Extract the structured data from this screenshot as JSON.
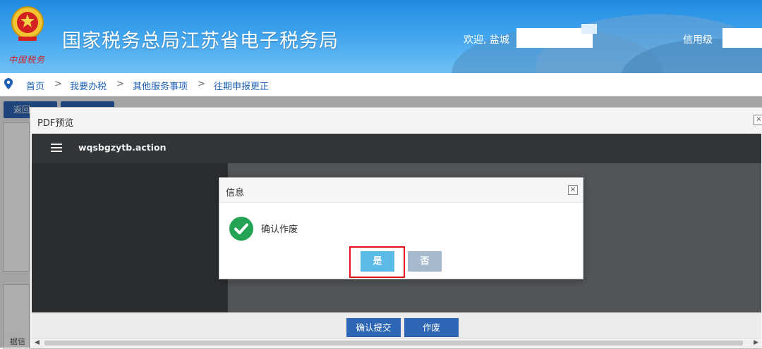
{
  "header": {
    "site_title": "国家税务总局江苏省电子税务局",
    "emblem_caption": "中国税务",
    "welcome": "欢迎, 盐城",
    "credit_label": "信用级"
  },
  "breadcrumb": [
    "首页",
    "我要办税",
    "其他服务事项",
    "往期申报更正"
  ],
  "breadcrumb_separator": ">",
  "page": {
    "back_button": "返回",
    "footer_text": "据信"
  },
  "pdf_preview": {
    "window_title": "PDF预览",
    "close_glyph": "×",
    "file_name": "wqsbgzytb.action",
    "confirm_submit": "确认提交",
    "void_button": "作废"
  },
  "dialog": {
    "title": "信息",
    "close_glyph": "×",
    "message": "确认作废",
    "yes": "是",
    "no": "否"
  },
  "colors": {
    "header_blue": "#1f8be0",
    "button_blue": "#2d66b5",
    "yes_button": "#5bbbe8",
    "no_button": "#a7b9cd",
    "success_green": "#23a455",
    "highlight_red": "#e2141b"
  }
}
